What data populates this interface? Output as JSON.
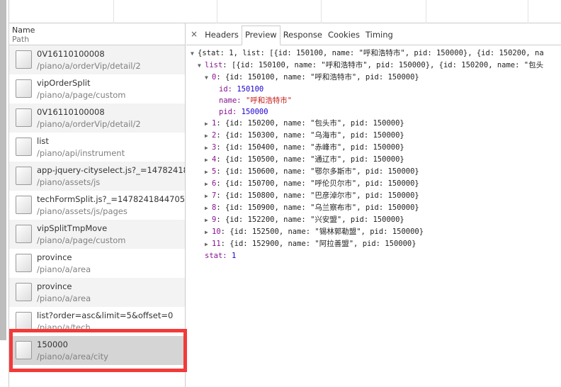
{
  "request_list": {
    "header": {
      "name": "Name",
      "path": "Path"
    },
    "rows": [
      {
        "name": "0V16110100008",
        "path": "/piano/a/orderVip/detail/2"
      },
      {
        "name": "vipOrderSplit",
        "path": "/piano/a/page/custom"
      },
      {
        "name": "0V16110100008",
        "path": "/piano/a/orderVip/detail/2"
      },
      {
        "name": "list",
        "path": "/piano/api/instrument"
      },
      {
        "name": "app-jquery-cityselect.js?_=147824184...",
        "path": "/piano/assets/js"
      },
      {
        "name": "techFormSplit.js?_=1478241844705",
        "path": "/piano/assets/js/pages"
      },
      {
        "name": "vipSplitTmpMove",
        "path": "/piano/a/page/custom"
      },
      {
        "name": "province",
        "path": "/piano/a/area"
      },
      {
        "name": "province",
        "path": "/piano/a/area"
      },
      {
        "name": "list?order=asc&limit=5&offset=0",
        "path": "/piano/a/tech"
      },
      {
        "name": "150000",
        "path": "/piano/a/area/city",
        "selected": true
      }
    ]
  },
  "detail": {
    "close": "×",
    "tabs": [
      "Headers",
      "Preview",
      "Response",
      "Cookies",
      "Timing"
    ],
    "active_tab": "Preview",
    "preview": {
      "root": "{stat: 1, list: [{id: 150100, name: \"呼和浩特市\", pid: 150000}, {id: 150200, na",
      "list_summary": ": [{id: 150100, name: \"呼和浩特市\", pid: 150000}, {id: 150200, name: \"包头",
      "list_key": "list",
      "item0": {
        "index": "0",
        "summary": ": {id: 150100, name: \"呼和浩特市\", pid: 150000}",
        "id": "150100",
        "name": "\"呼和浩特市\"",
        "pid": "150000"
      },
      "items": [
        {
          "index": "1",
          "text": ": {id: 150200, name: \"包头市\", pid: 150000}"
        },
        {
          "index": "2",
          "text": ": {id: 150300, name: \"乌海市\", pid: 150000}"
        },
        {
          "index": "3",
          "text": ": {id: 150400, name: \"赤峰市\", pid: 150000}"
        },
        {
          "index": "4",
          "text": ": {id: 150500, name: \"通辽市\", pid: 150000}"
        },
        {
          "index": "5",
          "text": ": {id: 150600, name: \"鄂尔多斯市\", pid: 150000}"
        },
        {
          "index": "6",
          "text": ": {id: 150700, name: \"呼伦贝尔市\", pid: 150000}"
        },
        {
          "index": "7",
          "text": ": {id: 150800, name: \"巴彦淖尔市\", pid: 150000}"
        },
        {
          "index": "8",
          "text": ": {id: 150900, name: \"乌兰察布市\", pid: 150000}"
        },
        {
          "index": "9",
          "text": ": {id: 152200, name: \"兴安盟\", pid: 150000}"
        },
        {
          "index": "10",
          "text": ": {id: 152500, name: \"锡林郭勒盟\", pid: 150000}"
        },
        {
          "index": "11",
          "text": ": {id: 152900, name: \"阿拉善盟\", pid: 150000}"
        }
      ],
      "stat_key": "stat",
      "stat_value": "1",
      "keys": {
        "id": "id",
        "name": "name",
        "pid": "pid"
      }
    }
  },
  "colors": {
    "highlight": "#f23a3a",
    "selected_row": "#d5d5d5",
    "key": "#881391",
    "number": "#1c00cf",
    "string": "#c41a16"
  }
}
